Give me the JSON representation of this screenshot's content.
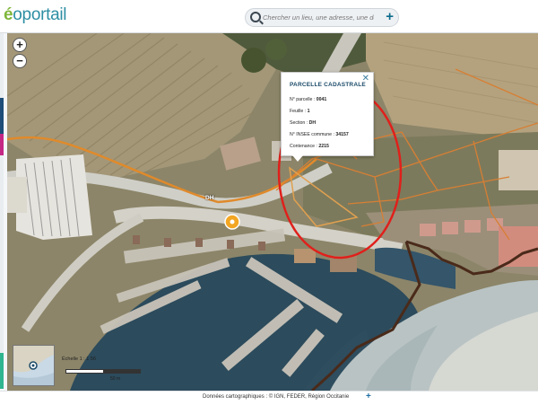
{
  "header": {
    "logo_lead": "é",
    "logo_text": "oportail",
    "search_placeholder": "Chercher un lieu, une adresse, une donnée",
    "search_add": "+"
  },
  "map": {
    "zoom_in": "+",
    "zoom_out": "−",
    "road_label": "DH",
    "popup": {
      "title": "PARCELLE CADASTRALE",
      "close": "✕",
      "rows": [
        {
          "label": "N° parcelle : ",
          "value": "0041"
        },
        {
          "label": "Feuille : ",
          "value": "1"
        },
        {
          "label": "Section : ",
          "value": "DH"
        },
        {
          "label": "N° INSEE commune : ",
          "value": "34157"
        },
        {
          "label": "Contenance : ",
          "value": "2215"
        }
      ]
    },
    "scale": {
      "label": "Échelle 1 : 1 56",
      "unit": "50 m"
    },
    "colors": {
      "road_orange": "#e08a2b",
      "parcel_line": "#d77f34",
      "coast_brown": "#4a2a1a",
      "highlight_circle": "#e0201b",
      "water": "#2c4b5c"
    }
  },
  "footer": {
    "credits": "Données cartographiques : ©   IGN, FEDER,  Région Occitanie",
    "more": "+"
  }
}
